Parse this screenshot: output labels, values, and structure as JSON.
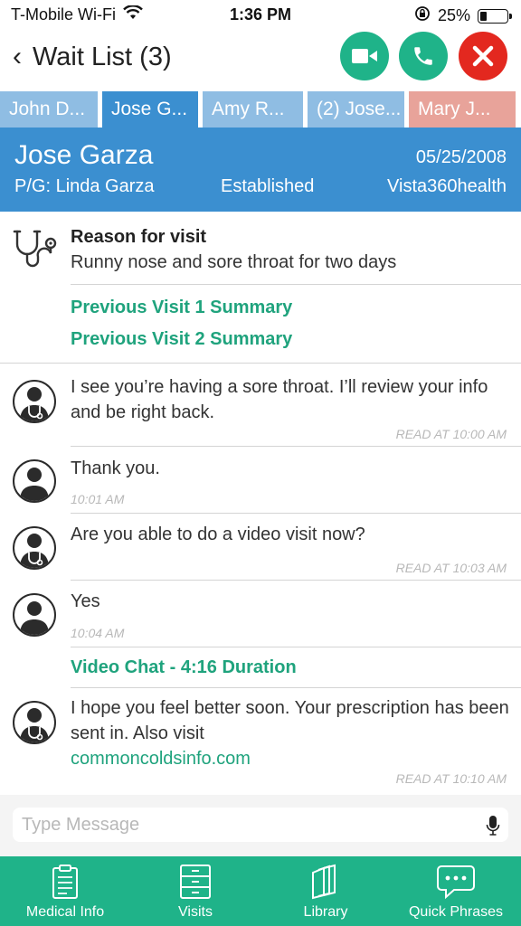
{
  "status_bar": {
    "carrier": "T-Mobile Wi-Fi",
    "time": "1:36 PM",
    "battery": "25%",
    "battery_level": 0.25
  },
  "nav": {
    "back_label": "‹",
    "title": "Wait List (3)"
  },
  "tabs": [
    {
      "label": "John D..."
    },
    {
      "label": "Jose G..."
    },
    {
      "label": "Amy R..."
    },
    {
      "label": "(2) Jose..."
    },
    {
      "label": "Mary J..."
    }
  ],
  "patient": {
    "name": "Jose Garza",
    "dob": "05/25/2008",
    "guardian": "P/G: Linda Garza",
    "status": "Established",
    "clinic": "Vista360health"
  },
  "reason": {
    "title": "Reason for visit",
    "text": "Runny nose and sore throat for two days",
    "previous_visits": [
      "Previous Visit 1 Summary",
      "Previous Visit 2 Summary"
    ]
  },
  "messages": [
    {
      "sender": "doctor",
      "text": "I see you’re having a sore throat. I’ll review your info and be right back.",
      "time": "READ AT 10:00 AM"
    },
    {
      "sender": "patient",
      "text": "Thank you.",
      "time": "10:01 AM"
    },
    {
      "sender": "doctor",
      "text": "Are you able to do a video visit now?",
      "time": "READ AT 10:03 AM"
    },
    {
      "sender": "patient",
      "text": "Yes",
      "time": "10:04 AM"
    },
    {
      "sender": "doctor",
      "text": "I hope you feel better soon. Your prescription has been sent in. Also visit",
      "link": "commoncoldsinfo.com",
      "time": "READ AT 10:10 AM"
    }
  ],
  "video_chat": "Video Chat - 4:16 Duration",
  "input": {
    "placeholder": "Type Message"
  },
  "bottom_nav": [
    {
      "label": "Medical Info",
      "icon": "clipboard-icon"
    },
    {
      "label": "Visits",
      "icon": "cabinet-icon"
    },
    {
      "label": "Library",
      "icon": "books-icon"
    },
    {
      "label": "Quick Phrases",
      "icon": "chat-bubble-icon"
    }
  ],
  "colors": {
    "accent_green": "#1fb389",
    "header_blue": "#3b8fd0",
    "tab_light_blue": "#8fbde3",
    "tab_salmon": "#e8a39a",
    "end_call_red": "#e3281f",
    "link_green": "#1fa37d"
  }
}
